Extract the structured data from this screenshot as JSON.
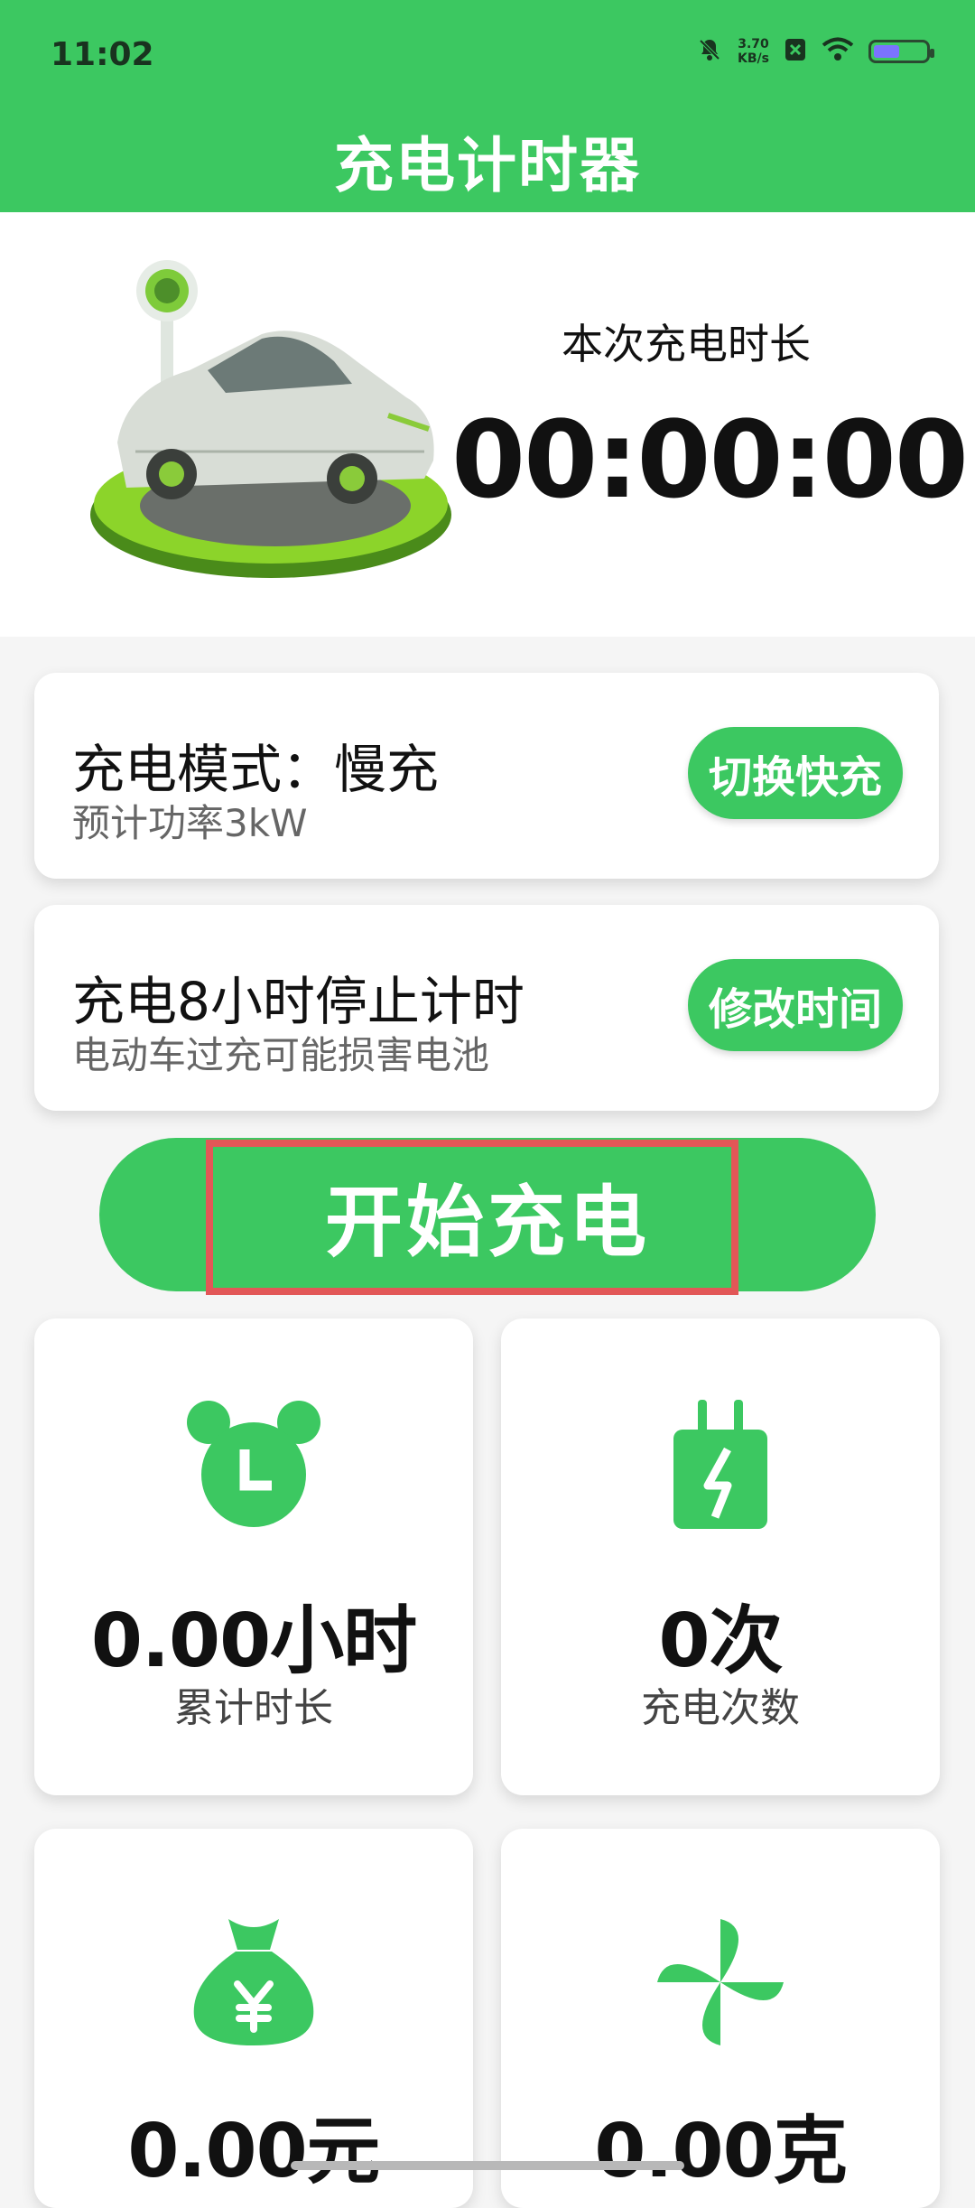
{
  "status_bar": {
    "time": "11:02",
    "net_speed_value": "3.70",
    "net_speed_unit": "KB/s",
    "icons": [
      "bell-muted-icon",
      "sim-off-icon",
      "wifi-icon",
      "battery-icon"
    ],
    "battery_level": 0.5
  },
  "header": {
    "title": "充电计时器"
  },
  "hero": {
    "label": "本次充电时长",
    "timer": "00:00:00",
    "image": "ev-charging-car-illustration"
  },
  "mode_card": {
    "title": "充电模式：慢充",
    "subtitle": "预计功率3kW",
    "button_label": "切换快充"
  },
  "timer_card": {
    "title": "充电8小时停止计时",
    "subtitle": "电动车过充可能损害电池",
    "button_label": "修改时间"
  },
  "start_button": {
    "label": "开始充电"
  },
  "stats": [
    {
      "value": "0.00小时",
      "label": "累计时长",
      "icon": "alarm-clock-icon"
    },
    {
      "value": "0次",
      "label": "充电次数",
      "icon": "charger-plug-icon"
    },
    {
      "value": "0.00元",
      "label": "",
      "icon": "money-bag-icon"
    },
    {
      "value": "0.00克",
      "label": "",
      "icon": "pinwheel-icon"
    }
  ],
  "colors": {
    "accent": "#3cc861",
    "highlight": "#e25757",
    "background": "#f5f5f5",
    "card": "#ffffff"
  }
}
